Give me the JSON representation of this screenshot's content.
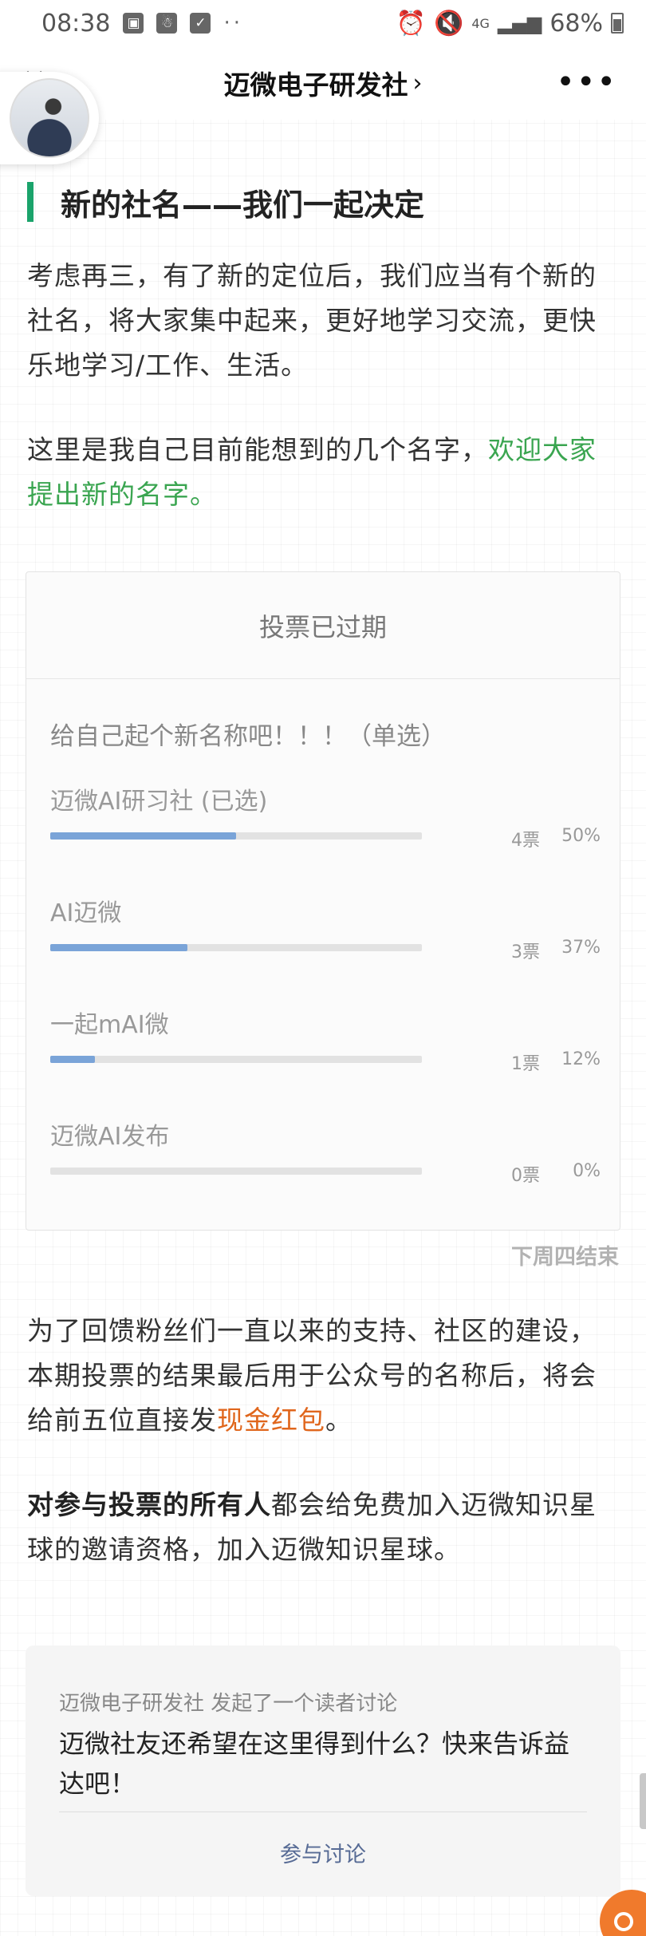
{
  "status_bar": {
    "time": "08:38",
    "dots": "··",
    "network": "4G",
    "battery": "68%"
  },
  "nav": {
    "title": "迈微电子研发社",
    "chevron": "›",
    "more": "•••",
    "close": "×"
  },
  "article": {
    "heading": "新的社名——我们一起决定",
    "para1": "考虑再三，有了新的定位后，我们应当有个新的社名，将大家集中起来，更好地学习交流，更快乐地学习/工作、生活。",
    "para2_prefix": "这里是我自己目前能想到的几个名字，",
    "para2_link": "欢迎大家提出新的名字。",
    "para3_prefix": "为了回馈粉丝们一直以来的支持、社区的建设，本期投票的结果最后用于公众号的名称后，将会给前五位直接发",
    "para3_highlight": "现金红包",
    "para3_suffix": "。",
    "para4_bold": "对参与投票的所有人",
    "para4_rest": "都会给免费加入迈微知识星球的邀请资格，加入迈微知识星球。"
  },
  "vote": {
    "status": "投票已过期",
    "question": "给自己起个新名称吧！！！（单选）",
    "options": [
      {
        "label": "迈微AI研习社 (已选)",
        "votes": "4票",
        "percent": "50%",
        "fraction": 0.5
      },
      {
        "label": "AI迈微",
        "votes": "3票",
        "percent": "37%",
        "fraction": 0.37
      },
      {
        "label": "一起mAI微",
        "votes": "1票",
        "percent": "12%",
        "fraction": 0.12
      },
      {
        "label": "迈微AI发布",
        "votes": "0票",
        "percent": "0%",
        "fraction": 0
      }
    ],
    "deadline": "下周四结束",
    "bar_color": "#7aa4d8"
  },
  "discussion": {
    "meta": "迈微电子研发社 发起了一个读者讨论",
    "text": "迈微社友还希望在这里得到什么？快来告诉益达吧！",
    "button": "参与讨论"
  },
  "colors": {
    "accent_green": "#1aa36b",
    "link_green": "#3aa550",
    "highlight_orange": "#e0661c"
  }
}
